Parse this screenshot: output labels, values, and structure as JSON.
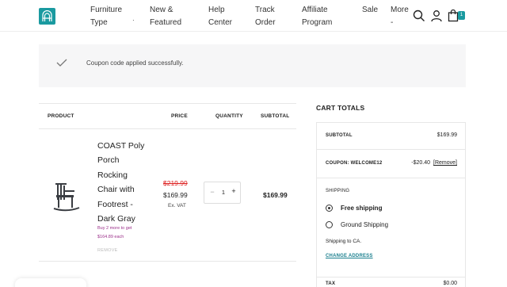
{
  "header": {
    "nav": [
      {
        "label": "Furniture\nType"
      },
      {
        "label": "New &\nFeatured"
      },
      {
        "label": "Help\nCenter"
      },
      {
        "label": "Track\nOrder"
      },
      {
        "label": "Affiliate\nProgram"
      },
      {
        "label": "Sale"
      },
      {
        "label": "More -"
      }
    ],
    "cart_count": "1",
    "accent": "#1a9aa0"
  },
  "notice": {
    "text": "Coupon code applied successfully.",
    "icon": "checkmark-icon"
  },
  "table": {
    "headers": {
      "product": "PRODUCT",
      "price": "PRICE",
      "quantity": "QUANTITY",
      "subtotal": "SUBTOTAL"
    },
    "item": {
      "name": "COAST Poly Porch Rocking Chair with Footrest - Dark Gray",
      "promo": "Buy 2 more to get $164.89 each",
      "remove": "REMOVE",
      "old_price": "$219.99",
      "price": "$169.99",
      "vat": "Ex. VAT",
      "quantity": "1",
      "subtotal": "$169.99"
    }
  },
  "cart_totals": {
    "title": "CART TOTALS",
    "subtotal_label": "SUBTOTAL",
    "subtotal_value": "$169.99",
    "coupon_label": "COUPON: WELCOME12",
    "coupon_value": "-$20.40",
    "coupon_remove": "[Remove]",
    "shipping_label": "SHIPPING",
    "options": [
      {
        "label": "Free shipping",
        "selected": true
      },
      {
        "label": "Ground Shipping",
        "selected": false
      }
    ],
    "ship_to": "Shipping to CA.",
    "change_address": "CHANGE ADDRESS",
    "tax_label": "TAX",
    "tax_value": "$0.00"
  }
}
